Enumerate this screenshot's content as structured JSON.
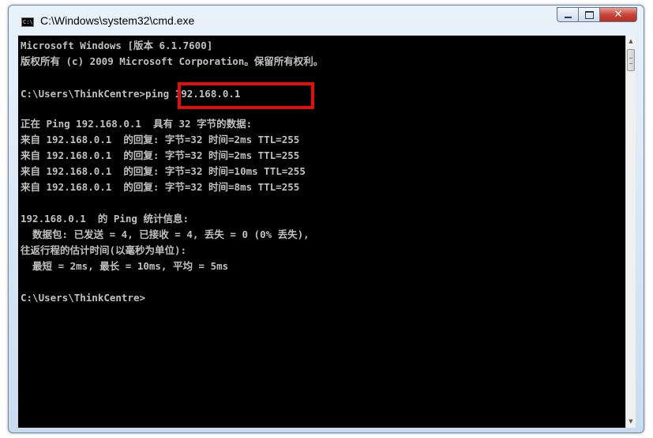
{
  "window": {
    "title": "C:\\Windows\\system32\\cmd.exe",
    "icon_text": "C:\\",
    "controls": {
      "minimize": "",
      "maximize": "",
      "close": "✕"
    }
  },
  "console": {
    "lines": [
      "Microsoft Windows [版本 6.1.7600]",
      "版权所有 (c) 2009 Microsoft Corporation。保留所有权利。",
      "",
      "C:\\Users\\ThinkCentre>ping 192.168.0.1",
      "",
      "正在 Ping 192.168.0.1  具有 32 字节的数据:",
      "来自 192.168.0.1  的回复: 字节=32 时间=2ms TTL=255",
      "来自 192.168.0.1  的回复: 字节=32 时间=2ms TTL=255",
      "来自 192.168.0.1  的回复: 字节=32 时间=10ms TTL=255",
      "来自 192.168.0.1  的回复: 字节=32 时间=8ms TTL=255",
      "",
      "192.168.0.1  的 Ping 统计信息:",
      "  数据包: 已发送 = 4, 已接收 = 4, 丢失 = 0 (0% 丢失),",
      "往返行程的估计时间(以毫秒为单位):",
      "  最短 = 2ms, 最长 = 10ms, 平均 = 5ms",
      "",
      "C:\\Users\\ThinkCentre>"
    ],
    "highlight_color": "#e01010",
    "text_color": "#c0c0c0",
    "background_color": "#000000"
  },
  "scrollbar": {
    "up_arrow": "▲",
    "down_arrow": "▼"
  }
}
